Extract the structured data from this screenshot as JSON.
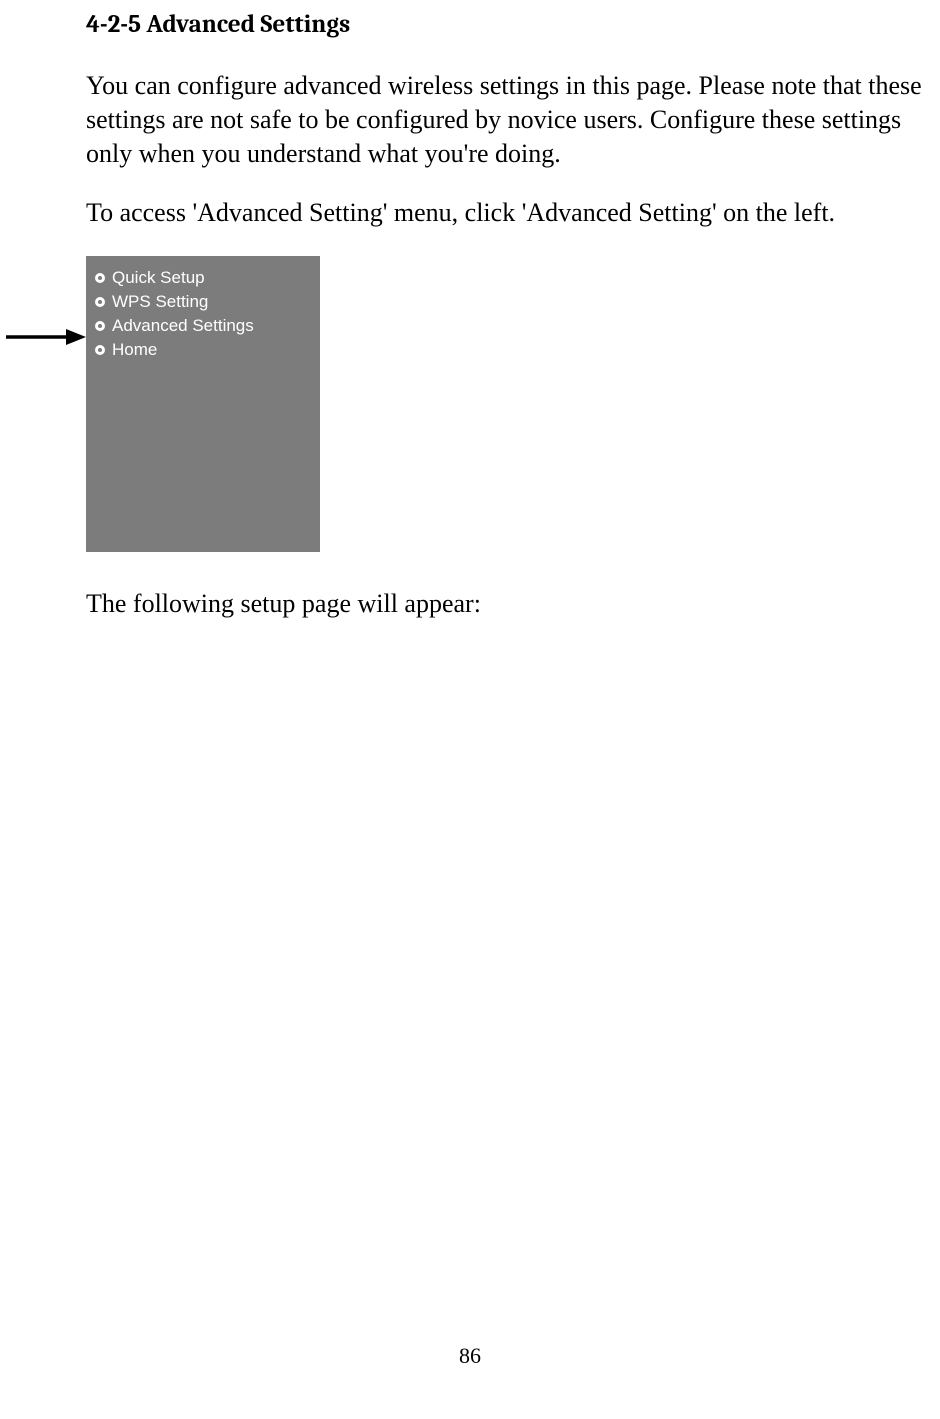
{
  "heading": "4-2-5 Advanced Settings",
  "para1": "You can configure advanced wireless settings in this page. Please note that these settings are not safe to be configured by novice users. Configure these settings only when you understand what you're doing.",
  "para2": "To access 'Advanced Setting' menu, click 'Advanced Setting' on the left.",
  "menu": {
    "items": [
      {
        "label": "Quick Setup"
      },
      {
        "label": "WPS Setting"
      },
      {
        "label": "Advanced Settings"
      },
      {
        "label": "Home"
      }
    ]
  },
  "para3": "The following setup page will appear:",
  "page_number": "86"
}
